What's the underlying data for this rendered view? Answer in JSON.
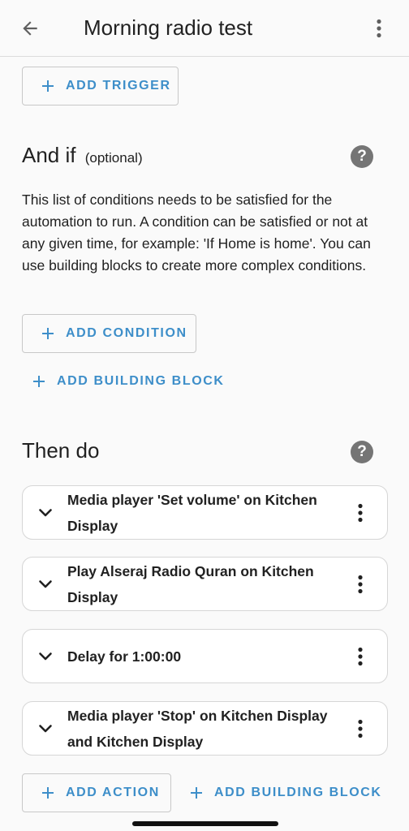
{
  "app_bar": {
    "title": "Morning radio test",
    "back_icon": "arrow-left-icon",
    "menu_icon": "dots-vertical-icon"
  },
  "triggers": {
    "add_label": "ADD TRIGGER"
  },
  "conditions": {
    "title": "And if",
    "optional_label": "(optional)",
    "help_icon_glyph": "?",
    "description": "This list of conditions needs to be satisfied for the automation to run. A condition can be satisfied or not at any given time, for example: 'If Home is home'. You can use building blocks to create more complex conditions.",
    "add_condition_label": "ADD CONDITION",
    "add_building_block_label": "ADD BUILDING BLOCK"
  },
  "actions": {
    "title": "Then do",
    "help_icon_glyph": "?",
    "items": [
      {
        "label": "Media player 'Set volume' on Kitchen Display"
      },
      {
        "label": "Play Alseraj Radio Quran on Kitchen Display"
      },
      {
        "label": "Delay for 1:00:00"
      },
      {
        "label": "Media player 'Stop' on Kitchen Display and Kitchen Display"
      }
    ],
    "add_action_label": "ADD ACTION",
    "add_building_block_label": "ADD BUILDING BLOCK"
  },
  "colors": {
    "accent": "#3d8ec9",
    "text": "#212121",
    "background": "#fafafa",
    "help_icon": "#757575"
  }
}
